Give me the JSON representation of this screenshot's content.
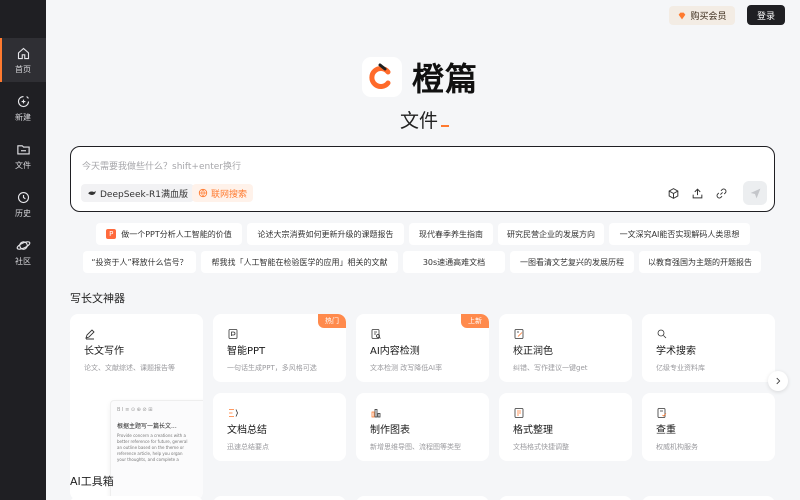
{
  "sidebar": {
    "items": [
      {
        "label": "首页",
        "icon": "home-icon",
        "active": true
      },
      {
        "label": "新建",
        "icon": "new-chat-icon"
      },
      {
        "label": "文件",
        "icon": "folder-icon"
      },
      {
        "label": "历史",
        "icon": "clock-icon"
      },
      {
        "label": "社区",
        "icon": "planet-icon"
      }
    ]
  },
  "header": {
    "vip_label": "购买会员",
    "login_label": "登录"
  },
  "brand": {
    "name": "橙篇",
    "subtitle": "文件",
    "accent": "#ff7a2f"
  },
  "input": {
    "placeholder": "今天需要我做些什么？shift+enter换行",
    "model_chip": "DeepSeek-R1满血版",
    "web_chip": "联网搜索"
  },
  "suggestions": [
    {
      "label": "做一个PPT分析人工智能的价值",
      "badge": "P"
    },
    {
      "label": "论述大宗消费如何更新升级的课题报告"
    },
    {
      "label": "现代春季养生指南"
    },
    {
      "label": "研究民营企业的发展方向"
    },
    {
      "label": "一文深究AI能否实现解码人类思想"
    },
    {
      "label": "“投资于人”释放什么信号？"
    },
    {
      "label": "帮我找「人工智能在检验医学的应用」相关的文献"
    },
    {
      "label": "30s速通高难文档"
    },
    {
      "label": "一图看清文艺复兴的发展历程"
    },
    {
      "label": "以教育强国为主题的开题报告"
    }
  ],
  "sections": {
    "writing_title": "写长文神器",
    "toolbox_title": "AI工具箱"
  },
  "cards": [
    {
      "title": "长文写作",
      "desc": "论文、文献综述、课题报告等",
      "icon": "pen-icon"
    },
    {
      "title": "智能PPT",
      "desc": "一句话生成PPT，多风格可选",
      "icon": "ppt-icon",
      "badge": "热门"
    },
    {
      "title": "AI内容检测",
      "desc": "文本检测 改写降低AI率",
      "icon": "detect-icon",
      "badge": "上新"
    },
    {
      "title": "校正润色",
      "desc": "纠错、写作建议一键get",
      "icon": "proofread-icon"
    },
    {
      "title": "学术搜索",
      "desc": "亿级专业资料库",
      "icon": "search-icon"
    },
    {
      "title": "文档总结",
      "desc": "迅速总结要点",
      "icon": "summary-icon"
    },
    {
      "title": "制作图表",
      "desc": "新增思维导图、流程图等类型",
      "icon": "chart-icon"
    },
    {
      "title": "格式整理",
      "desc": "文档格式快捷调整",
      "icon": "format-icon"
    },
    {
      "title": "查重",
      "desc": "权威机构服务",
      "icon": "check-icon"
    }
  ],
  "doc_preview": {
    "toolbar": "B I ≡ ⊙ ⊕ ⊘ ⊞",
    "title": "根据主题写一篇长文...",
    "lines": [
      "Provide concern a creations with a",
      "better reference for future, general",
      "an outline based on the theme or",
      "reference article, help you organ",
      "your thoughts, and complete a"
    ]
  }
}
